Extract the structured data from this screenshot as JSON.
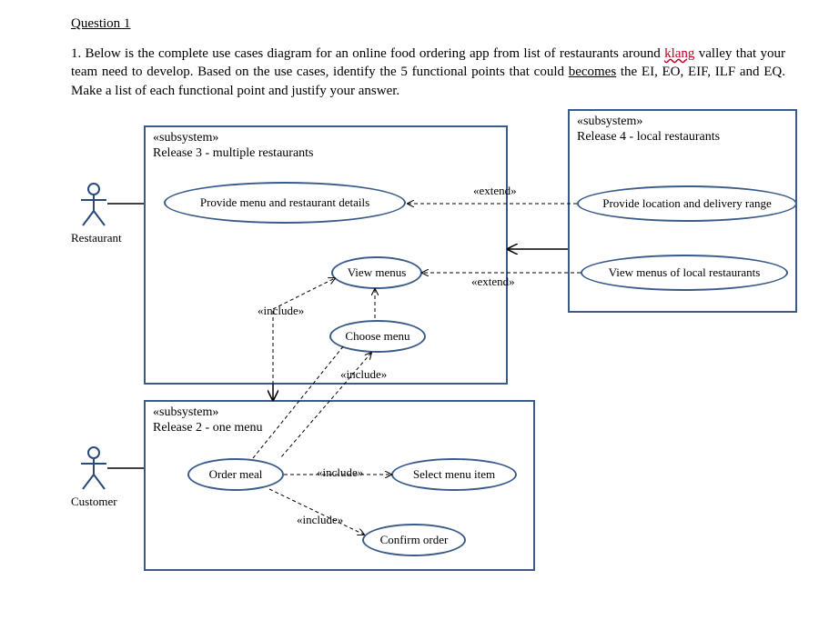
{
  "heading": "Question 1",
  "paragraph_parts": {
    "p1": "1. Below is the complete use cases diagram for an online food ordering app from list of restaurants around ",
    "p2_klang": "klang",
    "p3": " valley that your team need to develop. Based on the use cases, identify the 5 functional points that could ",
    "p4_becomes": "becomes",
    "p5": " the EI, EO, EIF, ILF and EQ. Make a list of each functional point and justify your answer."
  },
  "subsystems": {
    "r3": {
      "stereo": "«subsystem»",
      "title": "Release 3 - multiple restaurants"
    },
    "r4": {
      "stereo": "«subsystem»",
      "title": "Release 4 - local restaurants"
    },
    "r2": {
      "stereo": "«subsystem»",
      "title": "Release 2 - one menu"
    }
  },
  "usecases": {
    "provide_menu": "Provide menu and restaurant details",
    "view_menus": "View menus",
    "choose_menu": "Choose menu",
    "provide_loc": "Provide location and delivery range",
    "view_local": "View menus of local restaurants",
    "order_meal": "Order meal",
    "select_item": "Select menu item",
    "confirm": "Confirm order"
  },
  "labels": {
    "extend1": "«extend»",
    "extend2": "«extend»",
    "include1": "«include»",
    "include2": "«include»",
    "include3": "«include»",
    "include4": "«include»"
  },
  "actors": {
    "restaurant": "Restaurant",
    "customer": "Customer"
  }
}
